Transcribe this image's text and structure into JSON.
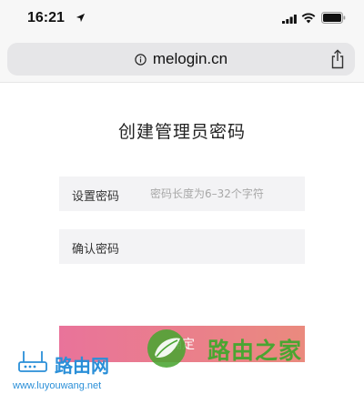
{
  "status_bar": {
    "time": "16:21"
  },
  "browser": {
    "url": "melogin.cn"
  },
  "page": {
    "title": "创建管理员密码",
    "set_password": {
      "label": "设置密码",
      "placeholder": "密码长度为6–32个字符",
      "value": ""
    },
    "confirm_password": {
      "label": "确认密码",
      "placeholder": "",
      "value": ""
    },
    "confirm_button": "确定"
  },
  "watermarks": {
    "left_text": "路由网",
    "left_url": "www.luyouwang.net",
    "right_text": "路由之家"
  },
  "colors": {
    "button_gradient_start": "#e9739a",
    "button_gradient_end": "#ea8a7e",
    "field_background": "#f3f3f5",
    "watermark_blue": "#2a8fd8",
    "watermark_green": "#4aa532"
  },
  "icons": [
    "location-arrow-icon",
    "signal-icon",
    "wifi-icon",
    "battery-icon",
    "info-icon",
    "share-icon",
    "router-icon",
    "leaf-logo-icon"
  ]
}
